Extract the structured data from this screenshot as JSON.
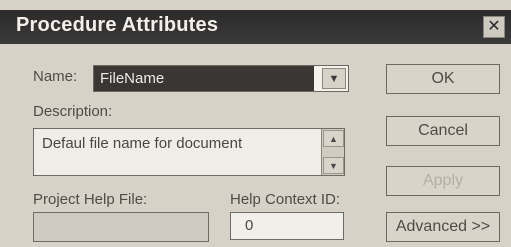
{
  "window": {
    "title": "Procedure Attributes",
    "close_glyph": "✕"
  },
  "fields": {
    "name_label": "Name:",
    "name_value": "FileName",
    "description_label": "Description:",
    "description_value": "Defaul file name for document",
    "project_help_label": "Project Help File:",
    "project_help_value": "",
    "help_context_label": "Help Context ID:",
    "help_context_value": "0"
  },
  "buttons": {
    "ok": "OK",
    "cancel": "Cancel",
    "apply": "Apply",
    "advanced": "Advanced >>"
  },
  "icons": {
    "dropdown_arrow": "chevron-down-icon",
    "scroll_up": "scroll-up-icon",
    "scroll_down": "scroll-down-icon"
  }
}
